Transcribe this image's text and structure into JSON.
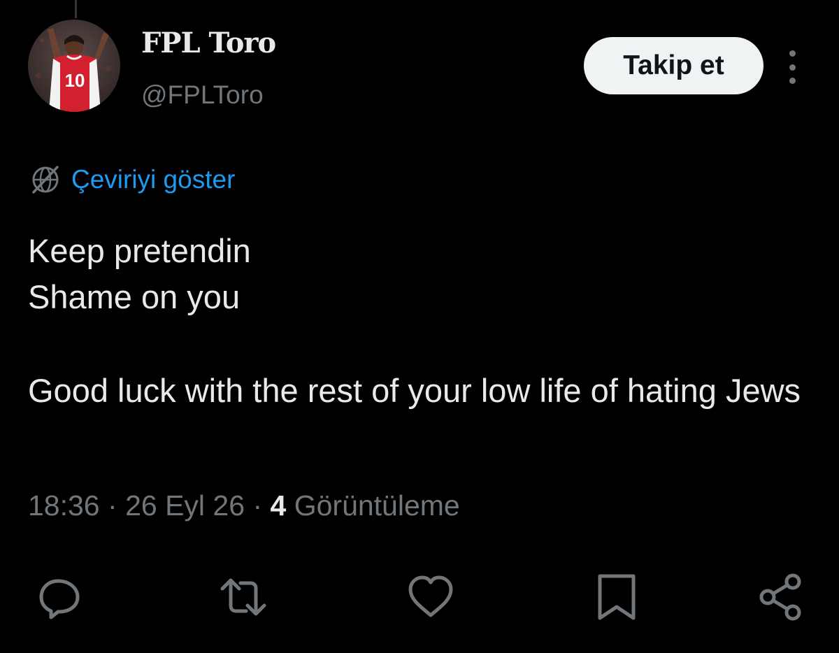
{
  "author": {
    "display_name": "FPL Toro",
    "handle": "@FPLToro",
    "avatar_jersey_number": "10"
  },
  "follow_button": {
    "label": "Takip et"
  },
  "translate": {
    "label": "Çeviriyi göster"
  },
  "tweet": {
    "lines": [
      "Keep pretendin",
      "Shame on you",
      "Good luck with the rest of your low life of hating Jews"
    ]
  },
  "meta": {
    "time": "18:36",
    "date": "26 Eyl 26",
    "separator": "·",
    "views_count": "4",
    "views_label": "Görüntüleme"
  },
  "actions": {
    "icons": [
      "reply-icon",
      "retweet-icon",
      "like-icon",
      "bookmark-icon",
      "share-icon"
    ]
  },
  "colors": {
    "background": "#000000",
    "text_primary": "#e7e9ea",
    "text_secondary": "#71767b",
    "link": "#1d9bf0",
    "button_bg": "#eff3f4",
    "jersey_red": "#d2202f"
  }
}
